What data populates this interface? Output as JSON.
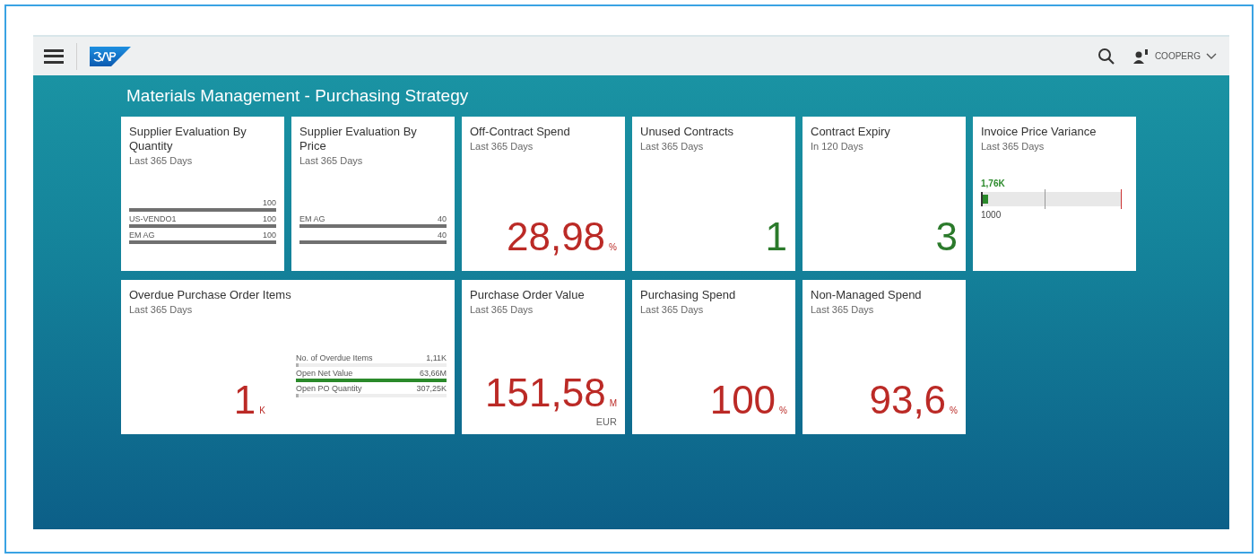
{
  "header": {
    "user": "COOPERG"
  },
  "page_title": "Materials Management - Purchasing Strategy",
  "tiles": [
    {
      "kind": "comparison",
      "title": "Supplier Evaluation By Quantity",
      "subtitle": "Last 365 Days",
      "rows": [
        {
          "value": "100",
          "level": 1
        },
        {
          "label": "US-VENDO1",
          "value": "100",
          "level": 1
        },
        {
          "label": "EM AG",
          "value": "100",
          "level": 1
        }
      ]
    },
    {
      "kind": "comparison",
      "title": "Supplier Evaluation By Price",
      "subtitle": "Last 365 Days",
      "rows": [
        {
          "label": "EM AG",
          "value": "40",
          "level": 1
        },
        {
          "value": "40",
          "level": 1
        }
      ]
    },
    {
      "kind": "numeric",
      "title": "Off-Contract Spend",
      "subtitle": "Last 365 Days",
      "value": "28,98",
      "unit": "%",
      "color": "#bb2a26"
    },
    {
      "kind": "numeric",
      "title": "Unused Contracts",
      "subtitle": "Last 365 Days",
      "value": "1",
      "color": "#2b7a2b"
    },
    {
      "kind": "numeric",
      "title": "Contract Expiry",
      "subtitle": "In 120 Days",
      "value": "3",
      "color": "#2b7a2b"
    },
    {
      "kind": "bullet",
      "title": "Invoice Price Variance",
      "subtitle": "Last 365 Days",
      "actual": "1,76K",
      "target": "1000",
      "level": 0.03
    },
    {
      "kind": "multi",
      "title": "Overdue Purchase Order Items",
      "subtitle": "Last 365 Days",
      "value": "1",
      "unit": "K",
      "color": "#bb2a26",
      "rows": [
        {
          "label": "No. of Overdue Items",
          "value": "1,11K",
          "level": 0.02,
          "color": "#b0b0b0"
        },
        {
          "label": "Open Net Value",
          "value": "63,66M",
          "level": 1,
          "color": "#2b8a2b"
        },
        {
          "label": "Open PO Quantity",
          "value": "307,25K",
          "level": 0.02,
          "color": "#b0b0b0"
        }
      ]
    },
    {
      "kind": "numeric",
      "title": "Purchase Order Value",
      "subtitle": "Last 365 Days",
      "value": "151,58",
      "unit": "M",
      "color": "#bb2a26",
      "footer": "EUR"
    },
    {
      "kind": "numeric",
      "title": "Purchasing Spend",
      "subtitle": "Last 365 Days",
      "value": "100",
      "unit": "%",
      "color": "#bb2a26"
    },
    {
      "kind": "numeric",
      "title": "Non-Managed Spend",
      "subtitle": "Last 365 Days",
      "value": "93,6",
      "unit": "%",
      "color": "#bb2a26"
    }
  ]
}
